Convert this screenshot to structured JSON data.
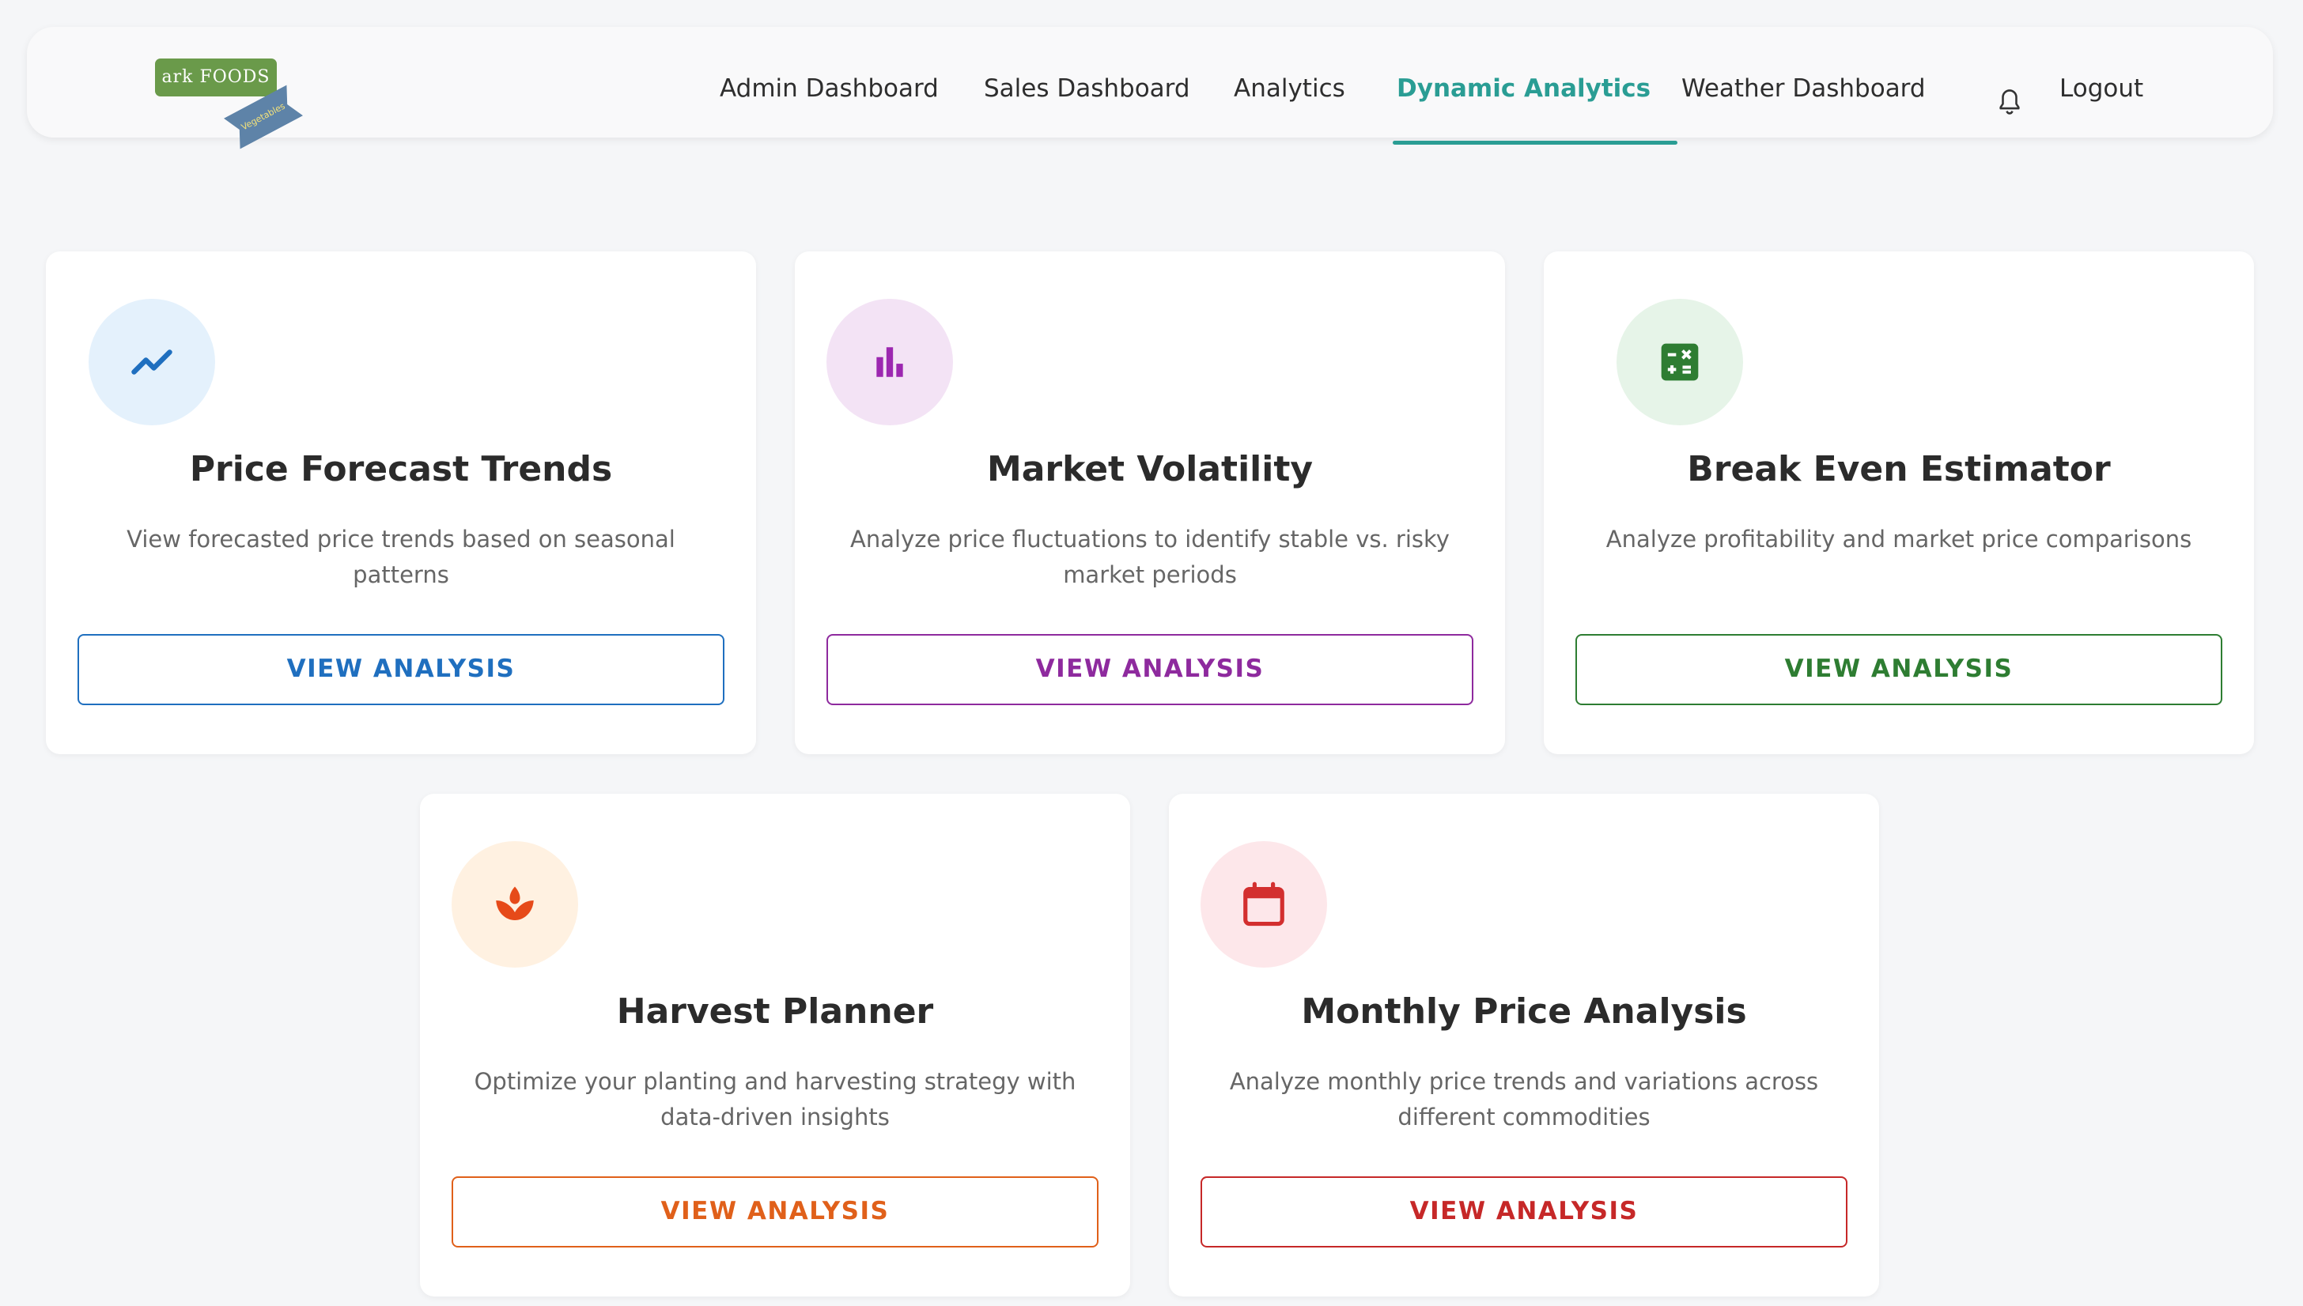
{
  "navbar": {
    "logo_text": "ark FOODS",
    "logo_ribbon_text": "Vegetables",
    "items": [
      {
        "label": "Admin Dashboard"
      },
      {
        "label": "Sales Dashboard"
      },
      {
        "label": "Analytics"
      },
      {
        "label": "Dynamic Analytics",
        "active": true
      },
      {
        "label": "Weather Dashboard"
      }
    ],
    "bell_icon": "bell-icon",
    "logout_label": "Logout",
    "accent_color": "#2a9d94"
  },
  "cards": [
    {
      "title": "Price Forecast Trends",
      "description": "View forecasted price trends based on seasonal patterns",
      "button_label": "VIEW ANALYSIS",
      "icon": "trending-up-icon",
      "color": "#1f6fbf"
    },
    {
      "title": "Market Volatility",
      "description": "Analyze price fluctuations to identify stable vs. risky market periods",
      "button_label": "VIEW ANALYSIS",
      "icon": "bar-chart-icon",
      "color": "#8e2a9e"
    },
    {
      "title": "Break Even Estimator",
      "description": "Analyze profitability and market price comparisons",
      "button_label": "VIEW ANALYSIS",
      "icon": "calculator-icon",
      "color": "#2e7d32"
    },
    {
      "title": "Harvest Planner",
      "description": "Optimize your planting and harvesting strategy with data-driven insights",
      "button_label": "VIEW ANALYSIS",
      "icon": "plant-icon",
      "color": "#e0601a"
    },
    {
      "title": "Monthly Price Analysis",
      "description": "Analyze monthly price trends and variations across different commodities",
      "button_label": "VIEW ANALYSIS",
      "icon": "calendar-icon",
      "color": "#c62828"
    }
  ]
}
